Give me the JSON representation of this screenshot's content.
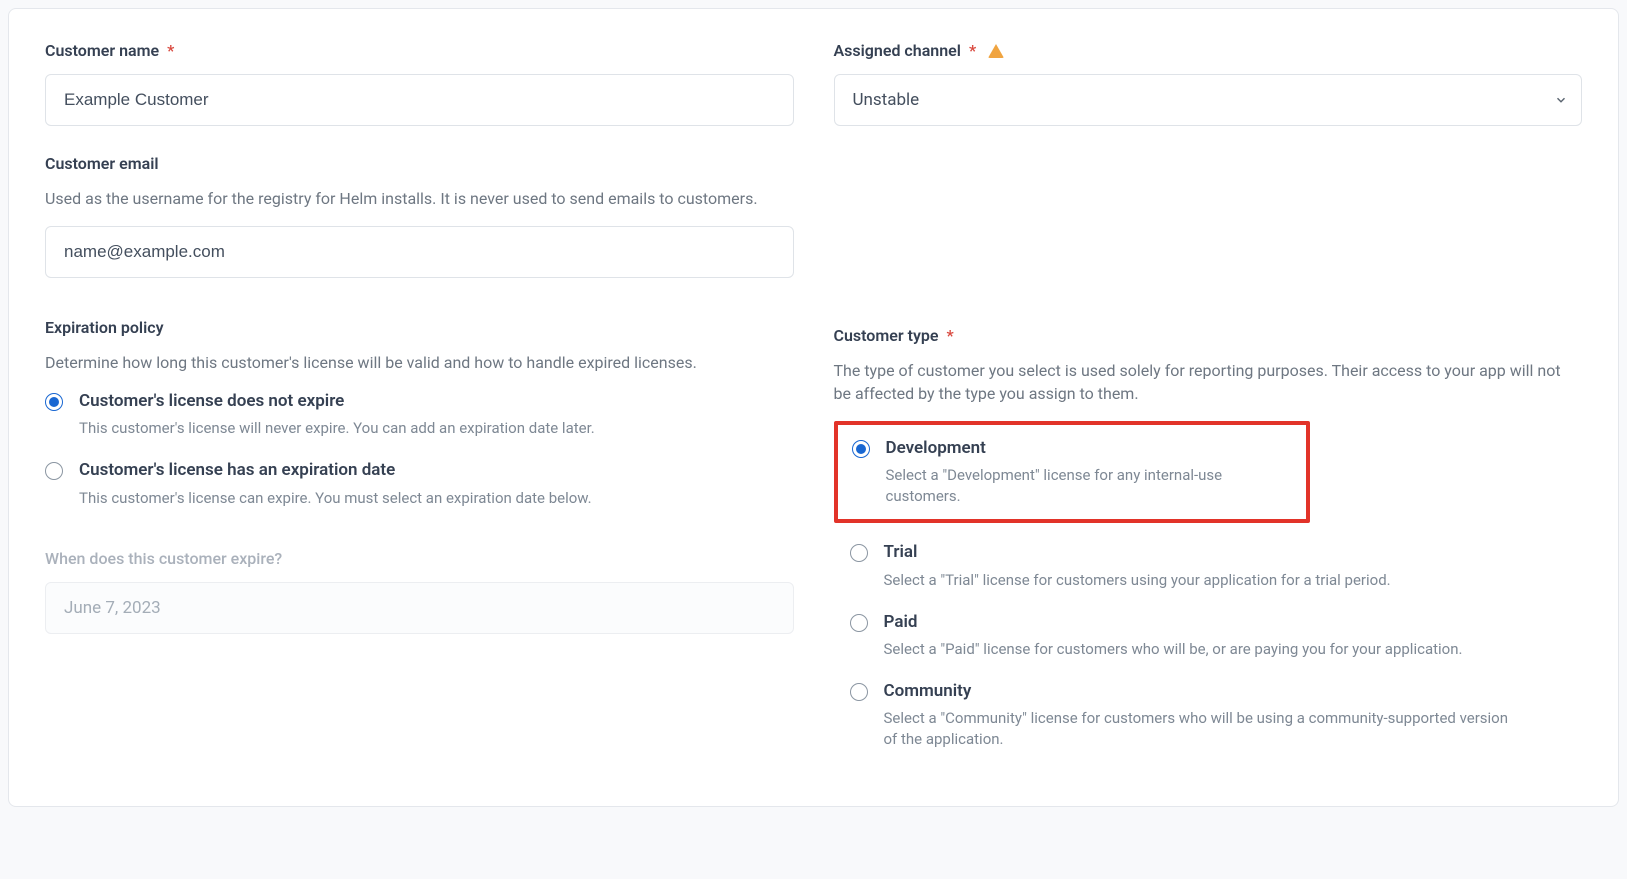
{
  "left": {
    "customerNameLabel": "Customer name",
    "customerNameValue": "Example Customer",
    "customerEmailLabel": "Customer email",
    "customerEmailHelp": "Used as the username for the registry for Helm installs. It is never used to send emails to customers.",
    "customerEmailValue": "name@example.com",
    "expirationLabel": "Expiration policy",
    "expirationHelp": "Determine how long this customer's license will be valid and how to handle expired licenses.",
    "expirationOptions": [
      {
        "title": "Customer's license does not expire",
        "desc": "This customer's license will never expire. You can add an expiration date later.",
        "selected": true
      },
      {
        "title": "Customer's license has an expiration date",
        "desc": "This customer's license can expire. You must select an expiration date below.",
        "selected": false
      }
    ],
    "expireDateLabel": "When does this customer expire?",
    "expireDateValue": "June 7, 2023"
  },
  "right": {
    "channelLabel": "Assigned channel",
    "channelValue": "Unstable",
    "typeLabel": "Customer type",
    "typeHelp": "The type of customer you select is used solely for reporting purposes. Their access to your app will not be affected by the type you assign to them.",
    "typeOptions": [
      {
        "title": "Development",
        "desc": "Select a \"Development\" license for any internal-use customers.",
        "selected": true,
        "highlighted": true
      },
      {
        "title": "Trial",
        "desc": "Select a \"Trial\" license for customers using your application for a trial period.",
        "selected": false,
        "highlighted": false
      },
      {
        "title": "Paid",
        "desc": "Select a \"Paid\" license for customers who will be, or are paying you for your application.",
        "selected": false,
        "highlighted": false
      },
      {
        "title": "Community",
        "desc": "Select a \"Community\" license for customers who will be using a community-supported version of the application.",
        "selected": false,
        "highlighted": false
      }
    ]
  }
}
